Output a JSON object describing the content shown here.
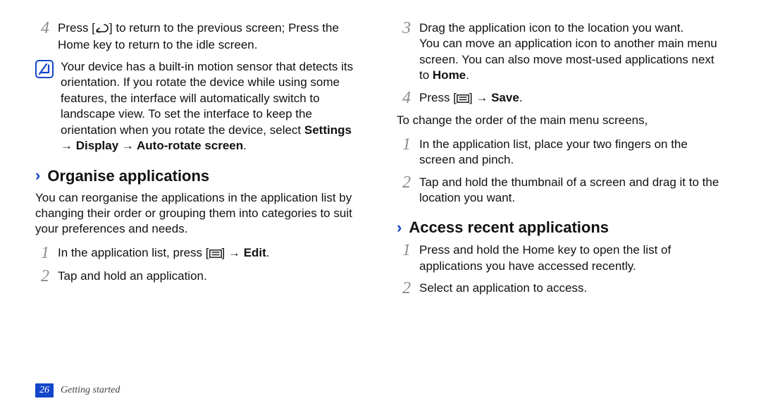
{
  "left": {
    "step4_a": "Press [",
    "step4_b": "] to return to the previous screen; Press the Home key to return to the idle screen.",
    "note_a": "Your device has a built-in motion sensor that detects its orientation. If you rotate the device while using some features, the interface will automatically switch to landscape view. To set the interface to keep the orientation when you rotate the device, select ",
    "note_bold": "Settings → Display → Auto-rotate screen",
    "note_end": ".",
    "h_organise": "Organise applications",
    "organise_intro": "You can reorganise the applications in the application list by changing their order or grouping them into categories to suit your preferences and needs.",
    "org_step1_a": "In the application list, press [",
    "org_step1_b": "] → ",
    "org_step1_bold": "Edit",
    "org_step1_end": ".",
    "org_step2": "Tap and hold an application."
  },
  "right": {
    "step3_line1": "Drag the application icon to the location you want.",
    "step3_line2a": "You can move an application icon to another main menu screen. You can also move most-used applications next to ",
    "step3_bold": "Home",
    "step3_end": ".",
    "step4_a": "Press [",
    "step4_b": "] → ",
    "step4_bold": "Save",
    "step4_end": ".",
    "change_order": "To change the order of the main menu screens,",
    "co_step1": "In the application list, place your two fingers on the screen and pinch.",
    "co_step2": "Tap and hold the thumbnail of a screen and drag it to the location you want.",
    "h_access": "Access recent applications",
    "acc_step1": "Press and hold the Home key to open the list of applications you have accessed recently.",
    "acc_step2": "Select an application to access."
  },
  "nums": {
    "n1": "1",
    "n2": "2",
    "n3": "3",
    "n4": "4"
  },
  "footer": {
    "page": "26",
    "section": "Getting started"
  }
}
